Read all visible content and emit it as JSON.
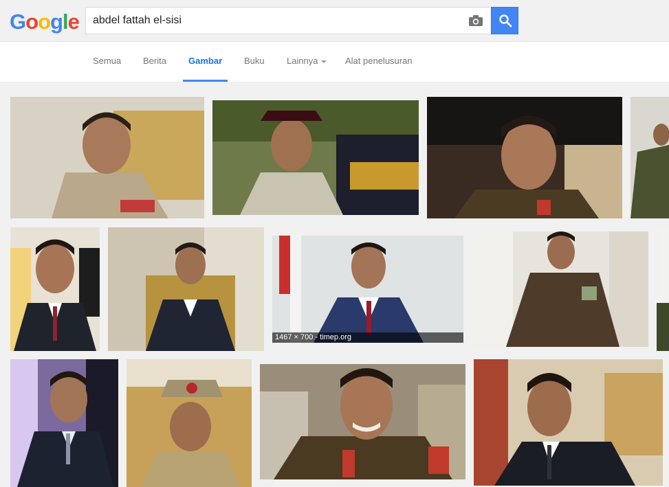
{
  "logo": {
    "letters": [
      "G",
      "o",
      "o",
      "g",
      "l",
      "e"
    ],
    "colors": [
      "#4285f4",
      "#ea4335",
      "#fbbc05",
      "#4285f4",
      "#34a853",
      "#ea4335"
    ]
  },
  "search": {
    "query": "abdel fattah el-sisi",
    "camera_icon": "camera-icon",
    "search_icon": "magnifier-icon"
  },
  "tabs": [
    {
      "label": "Semua"
    },
    {
      "label": "Berita"
    },
    {
      "label": "Gambar"
    },
    {
      "label": "Buku"
    },
    {
      "label": "Lainnya"
    },
    {
      "label": "Alat penelusuran"
    }
  ],
  "results": {
    "caption": "1467 × 700 - timep.org"
  },
  "colors": {
    "accent": "#4285f4",
    "active_tab": "#1a73e8"
  }
}
